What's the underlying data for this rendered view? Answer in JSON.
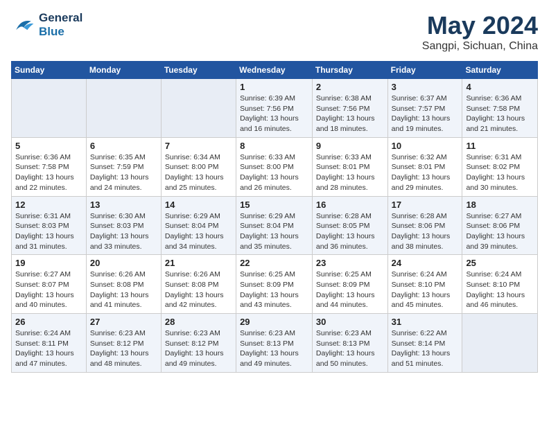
{
  "header": {
    "logo_line1": "General",
    "logo_line2": "Blue",
    "month": "May 2024",
    "location": "Sangpi, Sichuan, China"
  },
  "weekdays": [
    "Sunday",
    "Monday",
    "Tuesday",
    "Wednesday",
    "Thursday",
    "Friday",
    "Saturday"
  ],
  "weeks": [
    [
      {
        "day": "",
        "info": ""
      },
      {
        "day": "",
        "info": ""
      },
      {
        "day": "",
        "info": ""
      },
      {
        "day": "1",
        "info": "Sunrise: 6:39 AM\nSunset: 7:56 PM\nDaylight: 13 hours\nand 16 minutes."
      },
      {
        "day": "2",
        "info": "Sunrise: 6:38 AM\nSunset: 7:56 PM\nDaylight: 13 hours\nand 18 minutes."
      },
      {
        "day": "3",
        "info": "Sunrise: 6:37 AM\nSunset: 7:57 PM\nDaylight: 13 hours\nand 19 minutes."
      },
      {
        "day": "4",
        "info": "Sunrise: 6:36 AM\nSunset: 7:58 PM\nDaylight: 13 hours\nand 21 minutes."
      }
    ],
    [
      {
        "day": "5",
        "info": "Sunrise: 6:36 AM\nSunset: 7:58 PM\nDaylight: 13 hours\nand 22 minutes."
      },
      {
        "day": "6",
        "info": "Sunrise: 6:35 AM\nSunset: 7:59 PM\nDaylight: 13 hours\nand 24 minutes."
      },
      {
        "day": "7",
        "info": "Sunrise: 6:34 AM\nSunset: 8:00 PM\nDaylight: 13 hours\nand 25 minutes."
      },
      {
        "day": "8",
        "info": "Sunrise: 6:33 AM\nSunset: 8:00 PM\nDaylight: 13 hours\nand 26 minutes."
      },
      {
        "day": "9",
        "info": "Sunrise: 6:33 AM\nSunset: 8:01 PM\nDaylight: 13 hours\nand 28 minutes."
      },
      {
        "day": "10",
        "info": "Sunrise: 6:32 AM\nSunset: 8:01 PM\nDaylight: 13 hours\nand 29 minutes."
      },
      {
        "day": "11",
        "info": "Sunrise: 6:31 AM\nSunset: 8:02 PM\nDaylight: 13 hours\nand 30 minutes."
      }
    ],
    [
      {
        "day": "12",
        "info": "Sunrise: 6:31 AM\nSunset: 8:03 PM\nDaylight: 13 hours\nand 31 minutes."
      },
      {
        "day": "13",
        "info": "Sunrise: 6:30 AM\nSunset: 8:03 PM\nDaylight: 13 hours\nand 33 minutes."
      },
      {
        "day": "14",
        "info": "Sunrise: 6:29 AM\nSunset: 8:04 PM\nDaylight: 13 hours\nand 34 minutes."
      },
      {
        "day": "15",
        "info": "Sunrise: 6:29 AM\nSunset: 8:04 PM\nDaylight: 13 hours\nand 35 minutes."
      },
      {
        "day": "16",
        "info": "Sunrise: 6:28 AM\nSunset: 8:05 PM\nDaylight: 13 hours\nand 36 minutes."
      },
      {
        "day": "17",
        "info": "Sunrise: 6:28 AM\nSunset: 8:06 PM\nDaylight: 13 hours\nand 38 minutes."
      },
      {
        "day": "18",
        "info": "Sunrise: 6:27 AM\nSunset: 8:06 PM\nDaylight: 13 hours\nand 39 minutes."
      }
    ],
    [
      {
        "day": "19",
        "info": "Sunrise: 6:27 AM\nSunset: 8:07 PM\nDaylight: 13 hours\nand 40 minutes."
      },
      {
        "day": "20",
        "info": "Sunrise: 6:26 AM\nSunset: 8:08 PM\nDaylight: 13 hours\nand 41 minutes."
      },
      {
        "day": "21",
        "info": "Sunrise: 6:26 AM\nSunset: 8:08 PM\nDaylight: 13 hours\nand 42 minutes."
      },
      {
        "day": "22",
        "info": "Sunrise: 6:25 AM\nSunset: 8:09 PM\nDaylight: 13 hours\nand 43 minutes."
      },
      {
        "day": "23",
        "info": "Sunrise: 6:25 AM\nSunset: 8:09 PM\nDaylight: 13 hours\nand 44 minutes."
      },
      {
        "day": "24",
        "info": "Sunrise: 6:24 AM\nSunset: 8:10 PM\nDaylight: 13 hours\nand 45 minutes."
      },
      {
        "day": "25",
        "info": "Sunrise: 6:24 AM\nSunset: 8:10 PM\nDaylight: 13 hours\nand 46 minutes."
      }
    ],
    [
      {
        "day": "26",
        "info": "Sunrise: 6:24 AM\nSunset: 8:11 PM\nDaylight: 13 hours\nand 47 minutes."
      },
      {
        "day": "27",
        "info": "Sunrise: 6:23 AM\nSunset: 8:12 PM\nDaylight: 13 hours\nand 48 minutes."
      },
      {
        "day": "28",
        "info": "Sunrise: 6:23 AM\nSunset: 8:12 PM\nDaylight: 13 hours\nand 49 minutes."
      },
      {
        "day": "29",
        "info": "Sunrise: 6:23 AM\nSunset: 8:13 PM\nDaylight: 13 hours\nand 49 minutes."
      },
      {
        "day": "30",
        "info": "Sunrise: 6:23 AM\nSunset: 8:13 PM\nDaylight: 13 hours\nand 50 minutes."
      },
      {
        "day": "31",
        "info": "Sunrise: 6:22 AM\nSunset: 8:14 PM\nDaylight: 13 hours\nand 51 minutes."
      },
      {
        "day": "",
        "info": ""
      }
    ]
  ]
}
